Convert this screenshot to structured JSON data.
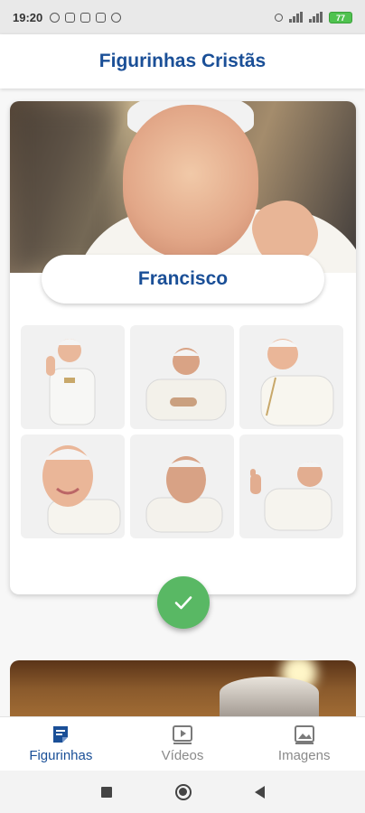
{
  "status_bar": {
    "time": "19:20",
    "battery": "77"
  },
  "app_bar": {
    "title": "Figurinhas Cristãs"
  },
  "pack": {
    "name": "Francisco",
    "stickers": [
      {
        "name": "sticker-1"
      },
      {
        "name": "sticker-2"
      },
      {
        "name": "sticker-3"
      },
      {
        "name": "sticker-4"
      },
      {
        "name": "sticker-5"
      },
      {
        "name": "sticker-6"
      }
    ]
  },
  "bottom_nav": {
    "items": [
      {
        "label": "Figurinhas",
        "icon": "sticker-note-icon",
        "active": true
      },
      {
        "label": "Vídeos",
        "icon": "video-icon",
        "active": false
      },
      {
        "label": "Imagens",
        "icon": "image-icon",
        "active": false
      }
    ]
  },
  "colors": {
    "accent": "#1a4f97",
    "fab": "#59b864"
  }
}
